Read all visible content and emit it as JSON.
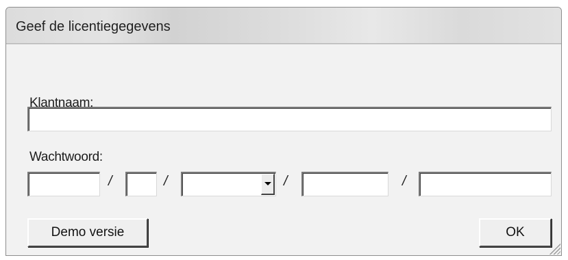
{
  "window": {
    "title": "Geef de licentiegegevens"
  },
  "form": {
    "customer_label": "Klantnaam:",
    "customer_value": "",
    "password_label": "Wachtwoord:",
    "password_parts": [
      "",
      "",
      "",
      ""
    ],
    "password_combo_value": "",
    "separator": "/"
  },
  "buttons": {
    "demo_label": "Demo versie",
    "ok_label": "OK"
  },
  "icons": {
    "combo_arrow": "chevron-down-icon",
    "resize_grip": "resize-grip-icon"
  }
}
